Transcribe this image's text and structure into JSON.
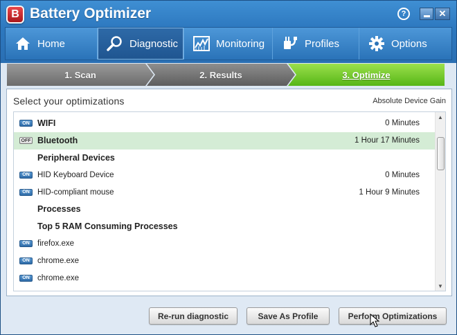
{
  "titlebar": {
    "app_logo_letter": "B",
    "app_title": "Battery Optimizer",
    "help_label": "?",
    "close_label": "✕"
  },
  "nav": [
    {
      "label": "Home",
      "icon": "home-icon"
    },
    {
      "label": "Diagnostic",
      "icon": "magnifier-icon",
      "active": true
    },
    {
      "label": "Monitoring",
      "icon": "chart-icon"
    },
    {
      "label": "Profiles",
      "icon": "plug-icon"
    },
    {
      "label": "Options",
      "icon": "gear-icon"
    }
  ],
  "steps": [
    {
      "label": "1. Scan"
    },
    {
      "label": "2. Results"
    },
    {
      "label": "3. Optimize",
      "active": true
    }
  ],
  "panel": {
    "title": "Select your optimizations",
    "column_header": "Absolute Device Gain"
  },
  "rows": [
    {
      "toggle": "ON",
      "label": "WIFI",
      "value": "0 Minutes",
      "bold": true
    },
    {
      "toggle": "OFF",
      "label": "Bluetooth",
      "value": "1 Hour 17 Minutes",
      "bold": true,
      "selected": true
    },
    {
      "toggle": "",
      "label": "Peripheral Devices",
      "value": "",
      "header": true
    },
    {
      "toggle": "ON",
      "label": "HID Keyboard Device",
      "value": "0 Minutes"
    },
    {
      "toggle": "ON",
      "label": "HID-compliant mouse",
      "value": "1 Hour 9 Minutes"
    },
    {
      "toggle": "",
      "label": "Processes",
      "value": "",
      "header": true
    },
    {
      "toggle": "",
      "label": "Top 5 RAM Consuming Processes",
      "value": "",
      "header": true
    },
    {
      "toggle": "ON",
      "label": "firefox.exe",
      "value": ""
    },
    {
      "toggle": "ON",
      "label": "chrome.exe",
      "value": ""
    },
    {
      "toggle": "ON",
      "label": "chrome.exe",
      "value": ""
    }
  ],
  "buttons": {
    "rerun": "Re-run diagnostic",
    "save": "Save As Profile",
    "perform": "Perform Optimizations"
  },
  "colors": {
    "accent": "#2d78bf",
    "active_step": "#56b617",
    "selected_row": "#d4ecd5"
  }
}
